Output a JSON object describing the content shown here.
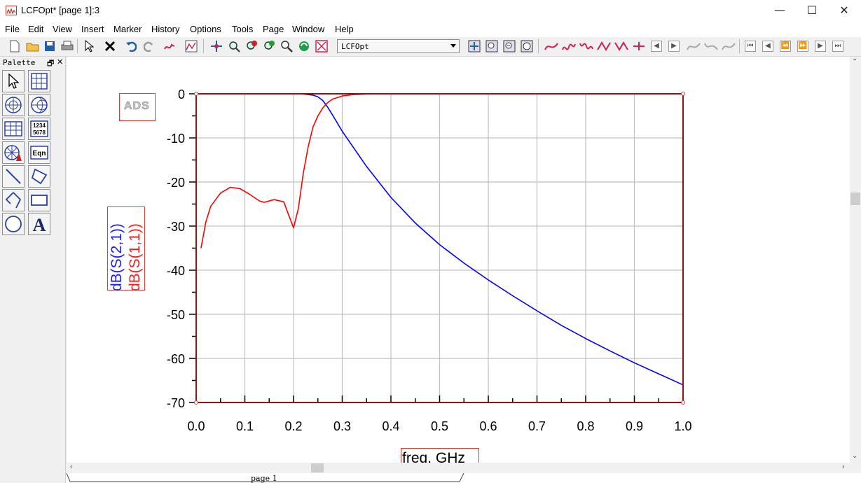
{
  "window": {
    "title": "LCFOpt* [page 1]:3",
    "min_glyph": "—",
    "max_glyph": "☐",
    "close_glyph": "✕"
  },
  "menu": [
    "File",
    "Edit",
    "View",
    "Insert",
    "Marker",
    "History",
    "Options",
    "Tools",
    "Page",
    "Window",
    "Help"
  ],
  "toolbar": {
    "design_select": "LCFOpt"
  },
  "palette": {
    "title": "Palette",
    "float_glyph": "🗗",
    "close_glyph": "✕",
    "tools": [
      "pointer-tool-icon",
      "rectangular-plot-icon",
      "polar-plot-icon",
      "smith-chart-icon",
      "list-table-icon",
      "numeric-table-icon",
      "antenna-plot-icon",
      "equation-icon",
      "line-tool-icon",
      "polygon-tool-icon",
      "polyline-tool-icon",
      "rectangle-tool-icon",
      "circle-tool-icon",
      "text-tool-icon"
    ],
    "eqn_label": "Eqn",
    "numeric_label_top": "1234",
    "numeric_label_bottom": "5678",
    "text_label": "A"
  },
  "ads_logo": "ADS",
  "tab": {
    "label": "page 1"
  },
  "chart_data": {
    "type": "line",
    "xlabel": "freq, GHz",
    "ylabel_series": [
      "dB(S(2,1))",
      "dB(S(1,1))"
    ],
    "xlim": [
      0.0,
      1.0
    ],
    "ylim": [
      -70,
      0
    ],
    "xticks": [
      "0.0",
      "0.1",
      "0.2",
      "0.3",
      "0.4",
      "0.5",
      "0.6",
      "0.7",
      "0.8",
      "0.9",
      "1.0"
    ],
    "yticks": [
      "0",
      "-10",
      "-20",
      "-30",
      "-40",
      "-50",
      "-60",
      "-70"
    ],
    "grid": true,
    "colors": {
      "s21": "#0000ff",
      "s11": "#ff0000",
      "grid": "#c0c0c0",
      "frame": "#000000"
    },
    "series": [
      {
        "name": "dB(S(2,1))",
        "color": "#0000ff",
        "x": [
          0.01,
          0.05,
          0.1,
          0.15,
          0.2,
          0.22,
          0.24,
          0.25,
          0.26,
          0.27,
          0.28,
          0.3,
          0.32,
          0.35,
          0.4,
          0.45,
          0.5,
          0.55,
          0.6,
          0.65,
          0.7,
          0.75,
          0.8,
          0.85,
          0.9,
          0.95,
          1.0
        ],
        "values": [
          0,
          0,
          0,
          0,
          0,
          -0.05,
          -0.3,
          -0.7,
          -1.5,
          -3.0,
          -4.8,
          -8.5,
          -11.7,
          -16.5,
          -23.5,
          -29.3,
          -34.2,
          -38.4,
          -42.2,
          -45.8,
          -49.2,
          -52.5,
          -55.5,
          -58.3,
          -61.0,
          -63.5,
          -66.0
        ]
      },
      {
        "name": "dB(S(1,1))",
        "color": "#ff0000",
        "x": [
          0.01,
          0.02,
          0.03,
          0.05,
          0.07,
          0.09,
          0.11,
          0.13,
          0.14,
          0.16,
          0.18,
          0.19,
          0.2,
          0.21,
          0.22,
          0.23,
          0.24,
          0.25,
          0.26,
          0.27,
          0.28,
          0.3,
          0.32,
          0.35,
          0.4,
          0.5,
          0.6,
          0.7,
          0.8,
          0.9,
          1.0
        ],
        "values": [
          -35,
          -29,
          -25.5,
          -22.5,
          -21.2,
          -21.5,
          -22.8,
          -24.3,
          -24.6,
          -24.0,
          -24.5,
          -27.5,
          -30.4,
          -26.0,
          -18.0,
          -12.0,
          -7.5,
          -5.0,
          -3.2,
          -2.0,
          -1.2,
          -0.5,
          -0.2,
          -0.05,
          0,
          0,
          0,
          0,
          0,
          0,
          0
        ]
      }
    ]
  }
}
